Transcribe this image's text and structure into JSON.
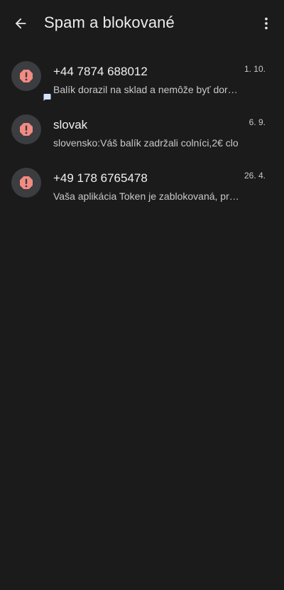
{
  "header": {
    "title": "Spam a blokované"
  },
  "conversations": [
    {
      "sender": "+44 7874 688012",
      "snippet": "Balík dorazil na sklad a nemôže byť doručený",
      "date": "1. 10."
    },
    {
      "sender": "slovak",
      "snippet": "slovensko:Váš balík zadržali colníci,2€ clo",
      "date": "6. 9."
    },
    {
      "sender": "+49 178 6765478",
      "snippet": "Vaša aplikácia Token je zablokovaná, prosím",
      "date": "26. 4."
    }
  ],
  "colors": {
    "background": "#1b1b1b",
    "avatar": "#3b3d40",
    "spam_alert": "#f28b82"
  }
}
